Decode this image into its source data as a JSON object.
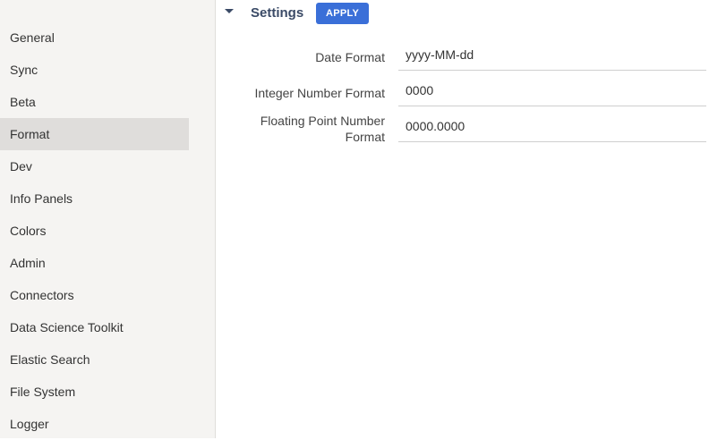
{
  "sidebar": {
    "items": [
      {
        "label": "General"
      },
      {
        "label": "Sync"
      },
      {
        "label": "Beta"
      },
      {
        "label": "Format"
      },
      {
        "label": "Dev"
      },
      {
        "label": "Info Panels"
      },
      {
        "label": "Colors"
      },
      {
        "label": "Admin"
      },
      {
        "label": "Connectors"
      },
      {
        "label": "Data Science Toolkit"
      },
      {
        "label": "Elastic Search"
      },
      {
        "label": "File System"
      },
      {
        "label": "Logger"
      }
    ],
    "active": "Format"
  },
  "header": {
    "title": "Settings",
    "apply_label": "APPLY"
  },
  "fields": [
    {
      "label": "Date Format",
      "value": "yyyy-MM-dd"
    },
    {
      "label": "Integer Number Format",
      "value": "0000"
    },
    {
      "label": "Floating Point Number Format",
      "value": "0000.0000"
    }
  ],
  "colors": {
    "accent": "#3a6fd8",
    "title": "#3a4a66",
    "sidebar_bg": "#f5f4f2",
    "sidebar_active": "#dfdddb"
  }
}
